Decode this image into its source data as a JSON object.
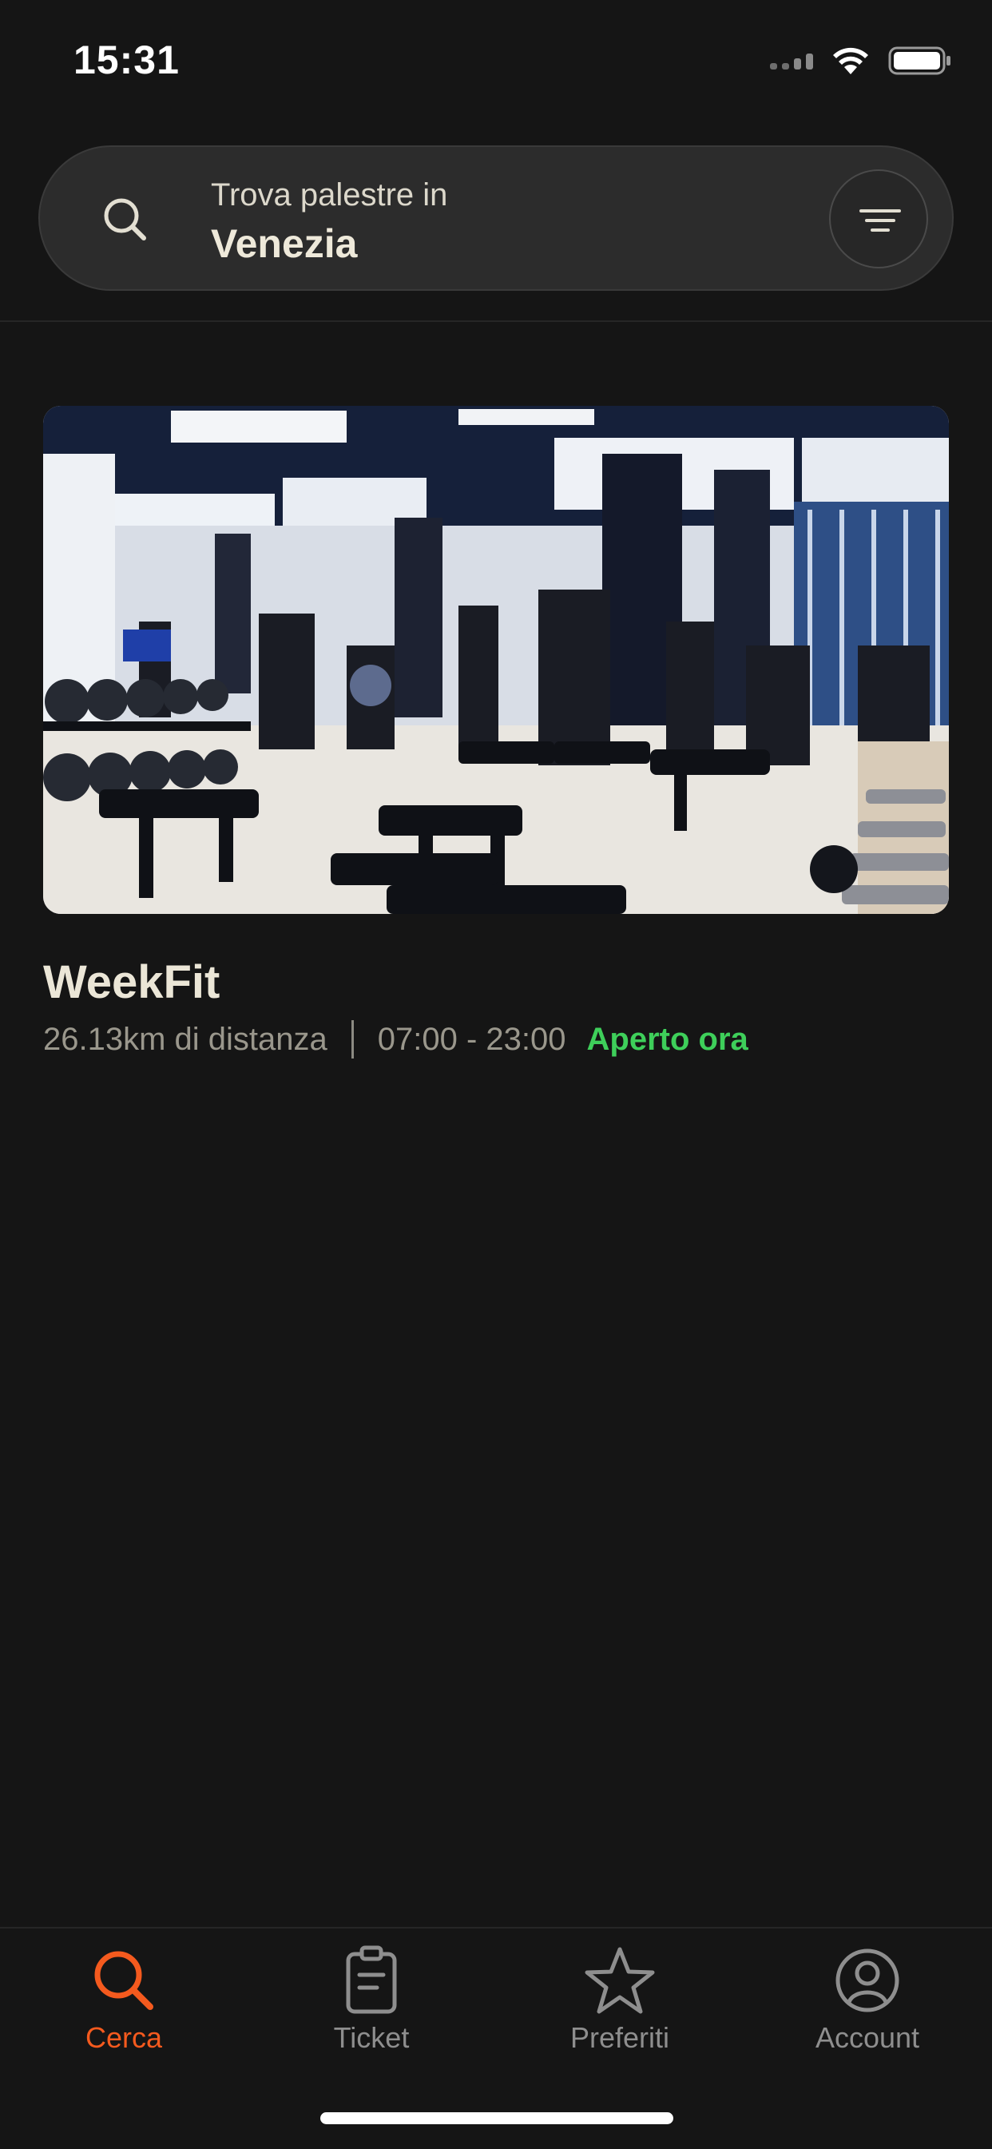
{
  "status_bar": {
    "time": "15:31"
  },
  "search": {
    "label": "Trova palestre in",
    "city": "Venezia"
  },
  "gym": {
    "name": "WeekFit",
    "distance": "26.13km di distanza",
    "hours": "07:00 - 23:00",
    "status": "Aperto ora",
    "status_color": "#3ecf5a"
  },
  "tabs": [
    {
      "label": "Cerca",
      "icon": "search-icon",
      "active": true
    },
    {
      "label": "Ticket",
      "icon": "ticket-icon",
      "active": false
    },
    {
      "label": "Preferiti",
      "icon": "star-icon",
      "active": false
    },
    {
      "label": "Account",
      "icon": "account-icon",
      "active": false
    }
  ],
  "colors": {
    "background": "#151515",
    "accent": "#f45a1e",
    "search_bar": "#2c2c2c"
  }
}
